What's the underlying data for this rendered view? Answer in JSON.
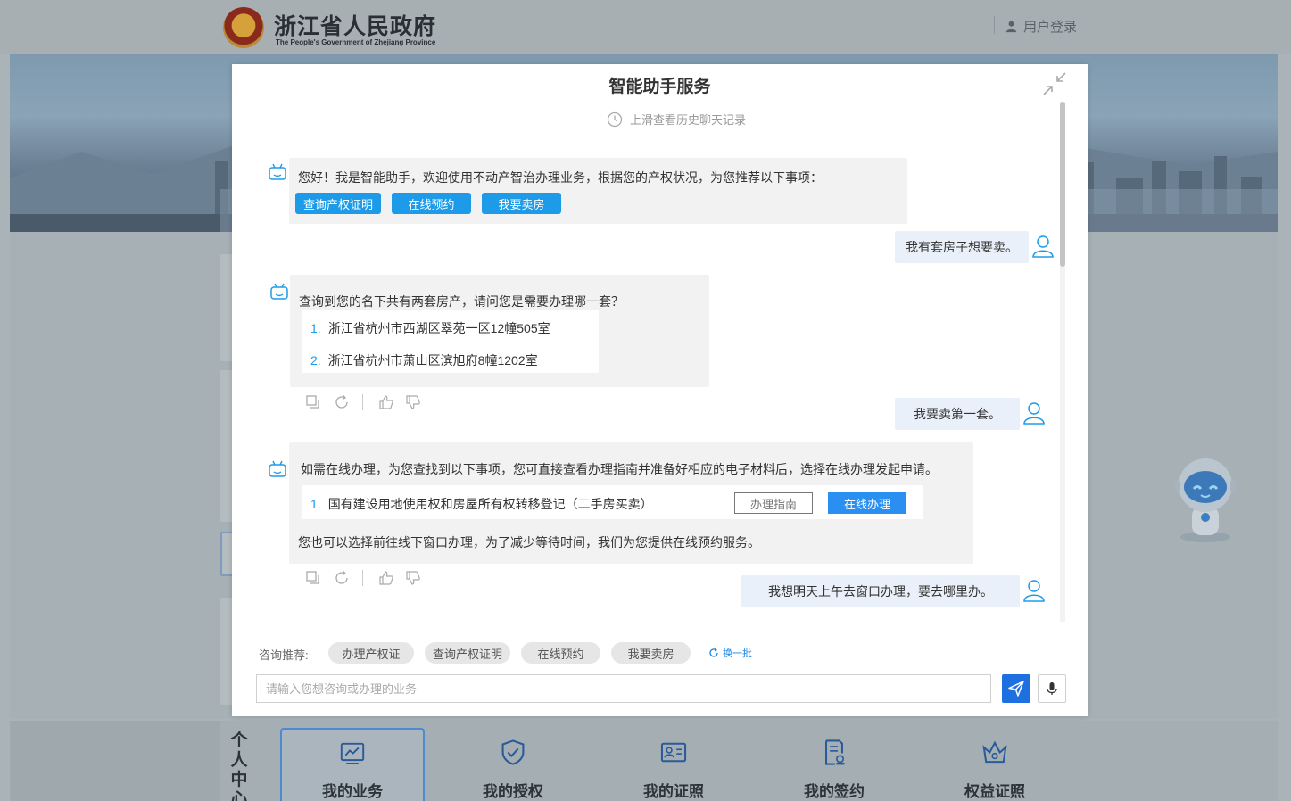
{
  "header": {
    "site_name_cn": "浙江省人民政府",
    "site_name_en": "The People's Government of Zhejiang Province",
    "login_label": "用户登录"
  },
  "personal_center": {
    "label": "个人中心",
    "items": [
      {
        "label": "我的业务",
        "icon": "chart-icon"
      },
      {
        "label": "我的授权",
        "icon": "shield-check-icon"
      },
      {
        "label": "我的证照",
        "icon": "id-card-icon"
      },
      {
        "label": "我的签约",
        "icon": "contract-icon"
      },
      {
        "label": "权益证照",
        "icon": "crown-icon"
      }
    ]
  },
  "assistant": {
    "title": "智能助手服务",
    "history_hint": "上滑查看历史聊天记录",
    "messages": [
      {
        "role": "bot",
        "text": "您好！我是智能助手，欢迎使用不动产智治办理业务，根据您的产权状况，为您推荐以下事项：",
        "chips": [
          "查询产权证明",
          "在线预约",
          "我要卖房"
        ]
      },
      {
        "role": "user",
        "text": "我有套房子想要卖。"
      },
      {
        "role": "bot",
        "text": "查询到您的名下共有两套房产，请问您是需要办理哪一套？",
        "list": [
          {
            "num": "1.",
            "text": "浙江省杭州市西湖区翠苑一区12幢505室"
          },
          {
            "num": "2.",
            "text": "浙江省杭州市萧山区滨旭府8幢1202室"
          }
        ]
      },
      {
        "role": "user",
        "text": "我要卖第一套。"
      },
      {
        "role": "bot",
        "text": "如需在线办理，为您查找到以下事项，您可直接查看办理指南并准备好相应的电子材料后，选择在线办理发起申请。",
        "item": {
          "num": "1.",
          "text": "国有建设用地使用权和房屋所有权转移登记（二手房买卖）",
          "guide_label": "办理指南",
          "online_label": "在线办理"
        },
        "footer": "您也可以选择前往线下窗口办理，为了减少等待时间，我们为您提供在线预约服务。"
      },
      {
        "role": "user",
        "text": "我想明天上午去窗口办理，要去哪里办。"
      }
    ],
    "recommend": {
      "label": "咨询推荐:",
      "chips": [
        "办理产权证",
        "查询产权证明",
        "在线预约",
        "我要卖房"
      ],
      "refresh_label": "换一批"
    },
    "input": {
      "placeholder": "请输入您想咨询或办理的业务",
      "value": ""
    }
  },
  "colors": {
    "accent": "#1e9be8",
    "primary_button": "#2a8ff0",
    "send_button": "#1e6fe0"
  }
}
